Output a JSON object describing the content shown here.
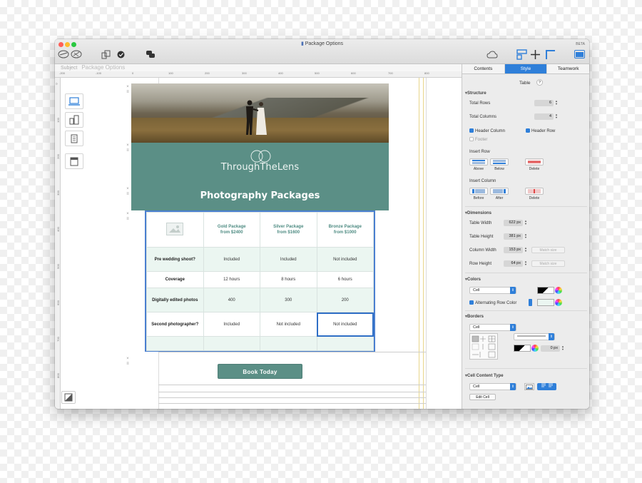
{
  "window": {
    "title": "Package Options",
    "badge": "BETA"
  },
  "subject": {
    "label": "Subject",
    "value": "Package Options"
  },
  "ruler": {
    "top_ticks": [
      "-200",
      "-100",
      "0",
      "100",
      "200",
      "300",
      "400",
      "500",
      "600",
      "700",
      "800"
    ],
    "left_ticks": [
      "0",
      "100",
      "200",
      "300",
      "400",
      "500",
      "600",
      "700",
      "800"
    ]
  },
  "email": {
    "brand_name": "ThroughTheLens",
    "section_title": "Photography Packages",
    "table": {
      "columns": [
        {
          "name": "Gold Package",
          "price": "from $2400"
        },
        {
          "name": "Silver Package",
          "price": "from $1600"
        },
        {
          "name": "Bronze Package",
          "price": "from $1000"
        }
      ],
      "rows": [
        {
          "label": "Pre wedding shoot?",
          "values": [
            "Included",
            "Included",
            "Not included"
          ]
        },
        {
          "label": "Coverage",
          "values": [
            "12 hours",
            "8 hours",
            "6 hours"
          ]
        },
        {
          "label": "Digitally edited photos",
          "values": [
            "400",
            "300",
            "200"
          ]
        },
        {
          "label": "Second photographer?",
          "values": [
            "Included",
            "Not included",
            "Not included"
          ]
        },
        {
          "label": "",
          "values": [
            "",
            "",
            ""
          ]
        }
      ]
    },
    "cta": "Book Today"
  },
  "inspector": {
    "tabs": [
      "Contents",
      "Style",
      "Teamwork"
    ],
    "active_tab": "Style",
    "heading": "Table",
    "help": "?",
    "structure": {
      "title": "Structure",
      "total_rows_label": "Total Rows",
      "total_rows": "6",
      "total_columns_label": "Total Columns",
      "total_columns": "4",
      "header_column": "Header Column",
      "header_row": "Header Row",
      "footer": "Footer",
      "insert_row": "Insert Row",
      "above": "Above",
      "below": "Below",
      "delete": "Delete",
      "insert_column": "Insert Column",
      "before": "Before",
      "after": "After"
    },
    "dimensions": {
      "title": "Dimensions",
      "table_width_label": "Table Width",
      "table_width": "622 px",
      "table_height_label": "Table Height",
      "table_height": "381 px",
      "column_width_label": "Column Width",
      "column_width": "153 px",
      "row_height_label": "Row Height",
      "row_height": "64 px",
      "match_size": "Match size"
    },
    "colors": {
      "title": "Colors",
      "target": "Cell",
      "alternating_row_color": "Alternating Row Color"
    },
    "borders": {
      "title": "Borders",
      "target": "Cell",
      "width": "0 px"
    },
    "cell_content_type": {
      "title": "Cell Content Type",
      "target": "Cell",
      "edit_cell": "Edit Cell"
    }
  }
}
